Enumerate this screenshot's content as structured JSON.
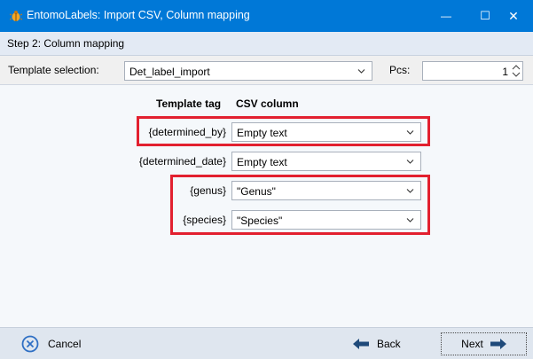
{
  "window": {
    "title": "EntomoLabels: Import CSV, Column mapping",
    "minimize_symbol": "—",
    "maximize_symbol": "☐",
    "close_symbol": "✕",
    "icon": "beetle-icon"
  },
  "step": {
    "label": "Step 2: Column mapping"
  },
  "toolbar": {
    "template_label": "Template selection:",
    "template_value": "Det_label_import",
    "pcs_label": "Pcs:",
    "pcs_value": "1"
  },
  "mapping": {
    "header_tag": "Template tag",
    "header_csv": "CSV column",
    "rows": [
      {
        "tag": "{determined_by}",
        "column": "Empty text"
      },
      {
        "tag": "{determined_date}",
        "column": "Empty text"
      },
      {
        "tag": "{genus}",
        "column": "\"Genus\""
      },
      {
        "tag": "{species}",
        "column": "\"Species\""
      }
    ]
  },
  "footer": {
    "cancel_label": "Cancel",
    "back_label": "Back",
    "next_label": "Next"
  },
  "colors": {
    "titlebar": "#0078d7",
    "highlight": "#e2202f",
    "accent_icon": "#2f6fc4"
  }
}
